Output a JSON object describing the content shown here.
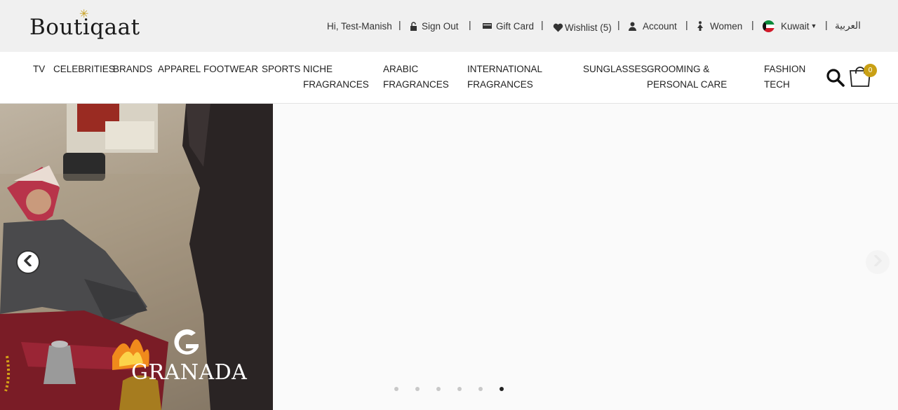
{
  "logo": {
    "text": "Boutiqaat"
  },
  "topbar": {
    "greeting": "Hi, Test-Manish",
    "sign_out": "Sign Out",
    "gift_card": "Gift Card",
    "wishlist": "Wishlist (5)",
    "account": "Account",
    "women": "Women",
    "country": "Kuwait",
    "language": "العربية"
  },
  "nav": {
    "items": [
      "TV",
      "CELEBRITIES",
      "BRANDS",
      "APPAREL",
      "FOOTWEAR",
      "SPORTS",
      "NICHE FRAGRANCES",
      "ARABIC FRAGRANCES",
      "INTERNATIONAL FRAGRANCES",
      "SUNGLASSES",
      "GROOMING & PERSONAL CARE",
      "FASHION TECH"
    ],
    "cart_count": "0"
  },
  "hero": {
    "brand": "GRANADA",
    "slide_count": 6,
    "active_slide": 6
  },
  "colors": {
    "topbar_bg": "#f0f0f0",
    "accent_gold": "#c9a015",
    "text": "#222222"
  }
}
